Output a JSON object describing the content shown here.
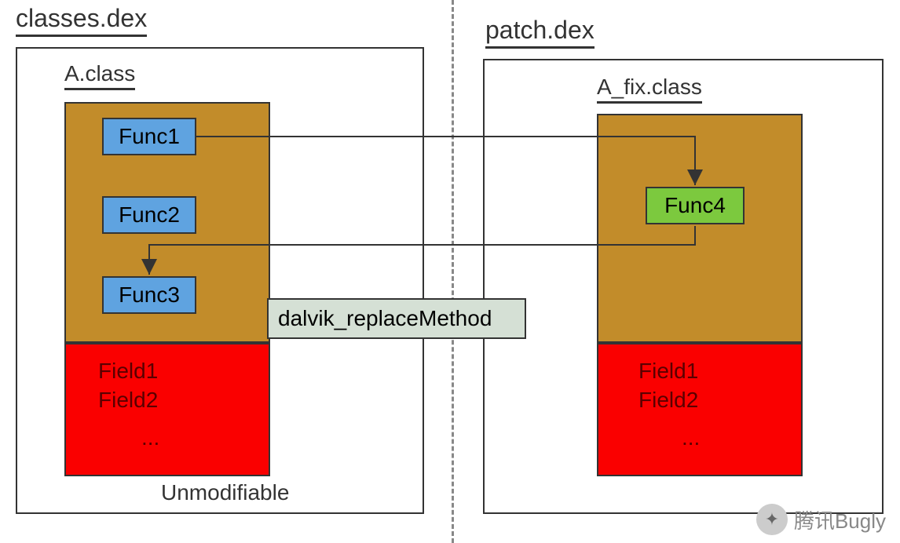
{
  "left": {
    "title": "classes.dex",
    "class_name": "A.class",
    "funcs": [
      "Func1",
      "Func2",
      "Func3"
    ],
    "fields": [
      "Field1",
      "Field2",
      "..."
    ],
    "unmodifiable": "Unmodifiable"
  },
  "right": {
    "title": "patch.dex",
    "class_name": "A_fix.class",
    "func": "Func4",
    "fields": [
      "Field1",
      "Field2",
      "..."
    ]
  },
  "replace_label": "dalvik_replaceMethod",
  "watermark": "腾讯Bugly"
}
